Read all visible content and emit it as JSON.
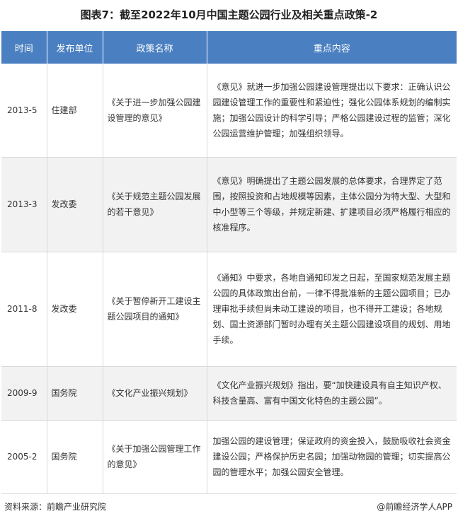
{
  "title": "图表7：截至2022年10月中国主题公园行业及相关重点政策-2",
  "table": {
    "headers": [
      "时间",
      "发布单位",
      "政策名称",
      "重点内容"
    ],
    "rows": [
      {
        "time": "2013-5",
        "unit": "住建部",
        "name": "《关于进一步加强公园建设管理的意见》",
        "content": "《意见》就进一步加强公园建设管理提出以下要求：正确认识公园建设管理工作的重要性和紧迫性；强化公园体系规划的编制实施；加强公园设计的科学引导；严格公园建设过程的监管；深化公园运营维护管理；加强组织领导。"
      },
      {
        "time": "2013-3",
        "unit": "发改委",
        "name": "《关于规范主题公园发展的若干意见》",
        "content": "《意见》明确提出了主题公园发展的总体要求，合理界定了范围，按照投资和占地规模等因素，主体公园分为特大型、大型和中小型等三个等级，并规定新建、扩建项目必须严格履行相应的核准程序。"
      },
      {
        "time": "2011-8",
        "unit": "发改委",
        "name": "《关于暂停新开工建设主题公园项目的通知》",
        "content": "《通知》中要求，各地自通知印发之日起，至国家规范发展主题公园的具体政策出台前，一律不得批准新的主题公园项目；已办理审批手续但尚未动工建设的项目，也不得开工建设；各地规划、国土资源部门暂时办理有关主题公园建设项目的规划、用地手续。"
      },
      {
        "time": "2009-9",
        "unit": "国务院",
        "name": "《文化产业振兴规划》",
        "content": "《文化产业振兴规划》指出，要“加快建设具有自主知识产权、科技含量高、富有中国文化特色的主题公园”。"
      },
      {
        "time": "2005-2",
        "unit": "国务院",
        "name": "《关于加强公园管理工作的意见》",
        "content": "加强公园的建设管理；保证政府的资金投入，鼓励吸收社会资金建设公园；严格保护历史名园；加强动物园的管理；切实提高公园的管理水平；加强公园安全管理。"
      }
    ]
  },
  "footer": {
    "source": "资料来源：前瞻产业研究院",
    "credit": "@前瞻经济学人APP"
  }
}
